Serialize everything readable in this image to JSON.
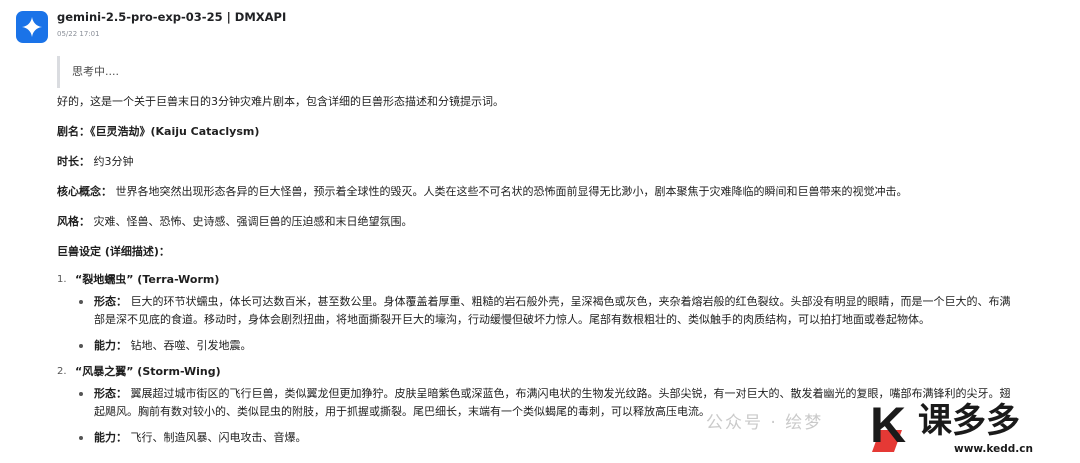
{
  "header": {
    "model_name": "gemini-2.5-pro-exp-03-25 | DMXAPI",
    "timestamp": "05/22 17:01",
    "avatar_icon": "gemini-sparkle-icon",
    "avatar_color": "#1a73e8"
  },
  "message": {
    "thinking": "思考中....",
    "intro": "好的，这是一个关于巨兽末日的3分钟灾难片剧本，包含详细的巨兽形态描述和分镜提示词。",
    "title_label": "剧名：",
    "title_value": "《巨灵浩劫》(Kaiju Cataclysm)",
    "duration_label": "时长：",
    "duration_value": "约3分钟",
    "concept_label": "核心概念：",
    "concept_value": "世界各地突然出现形态各异的巨大怪兽，预示着全球性的毁灭。人类在这些不可名状的恐怖面前显得无比渺小，剧本聚焦于灾难降临的瞬间和巨兽带来的视觉冲击。",
    "style_label": "风格：",
    "style_value": "灾难、怪兽、恐怖、史诗感、强调巨兽的压迫感和末日绝望氛围。",
    "section_title": "巨兽设定 (详细描述)：",
    "monsters": [
      {
        "number": "1.",
        "name": "“裂地蠕虫” (Terra-Worm)",
        "form_label": "形态：",
        "form_line1": "巨大的环节状蠕虫，体长可达数百米，甚至数公里。身体覆盖着厚重、粗糙的岩石般外壳，呈深褐色或灰色，夹杂着熔岩般的红色裂纹。头部没有明显的眼睛，而是一个巨大的、布满",
        "form_line2": "部是深不见底的食道。移动时，身体会剧烈扭曲，将地面撕裂开巨大的壕沟，行动缓慢但破坏力惊人。尾部有数根粗壮的、类似触手的肉质结构，可以拍打地面或卷起物体。",
        "ability_label": "能力：",
        "ability_value": "钻地、吞噬、引发地震。"
      },
      {
        "number": "2.",
        "name": "“风暴之翼” (Storm-Wing)",
        "form_label": "形态：",
        "form_line1": "翼展超过城市街区的飞行巨兽，类似翼龙但更加狰狞。皮肤呈暗紫色或深蓝色，布满闪电状的生物发光纹路。头部尖锐，有一对巨大的、散发着幽光的复眼，嘴部布满锋利的尖牙。翅",
        "form_line2": "起飓风。胸前有数对较小的、类似昆虫的附肢，用于抓握或撕裂。尾巴细长，末端有一个类似蝎尾的毒刺，可以释放高压电流。",
        "ability_label": "能力：",
        "ability_value": "飞行、制造风暴、闪电攻击、音爆。"
      }
    ]
  },
  "watermark": {
    "text": "公众号 · 绘梦",
    "logo_cn": "课多多",
    "logo_url": "www.kedd.cn",
    "logo_accent": "#e53935"
  }
}
